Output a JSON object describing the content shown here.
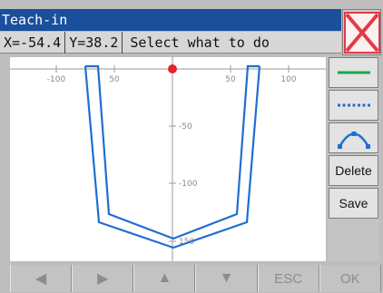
{
  "window": {
    "title": "Teach-in"
  },
  "status": {
    "x_readout": "X=-54.4",
    "y_readout": "Y=38.2",
    "message": "Select what to do"
  },
  "plot": {
    "x_ticks": [
      "-100",
      "50",
      "50",
      "100"
    ],
    "y_ticks": [
      "-50",
      "-100",
      "150"
    ]
  },
  "tools": {
    "line_icon": "solid-line-icon",
    "dotted_icon": "dashed-line-icon",
    "arc_icon": "arc-icon",
    "delete_label": "Delete",
    "save_label": "Save"
  },
  "nav": {
    "left_icon": "◀",
    "right_icon": "▶",
    "up_icon": "▲",
    "down_icon": "▼",
    "esc_label": "ESC",
    "ok_label": "OK"
  },
  "colors": {
    "title_bar": "#1a4f9c",
    "path": "#1f6fd1",
    "cursor_point": "#e8232b",
    "close_icon": "#e23a45",
    "tool_line": "#1aa84a",
    "tool_dotted": "#1f6fd1"
  }
}
